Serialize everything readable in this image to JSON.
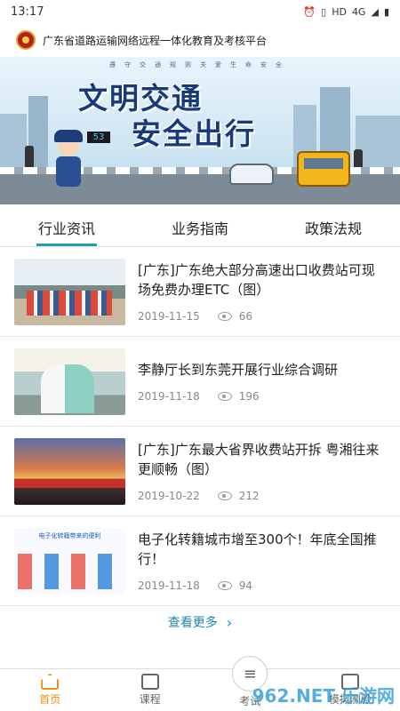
{
  "status_bar": {
    "time": "13:17",
    "network": "4G",
    "hd": "HD"
  },
  "app": {
    "title": "广东省道路运输网络远程一体化教育及考核平台"
  },
  "banner": {
    "subtitle": "遵守交通规则关爱生命安全",
    "line1": "文明交通",
    "line2": "安全出行",
    "sign_number": "53"
  },
  "tabs": [
    {
      "label": "行业资讯",
      "active": true
    },
    {
      "label": "业务指南",
      "active": false
    },
    {
      "label": "政策法规",
      "active": false
    }
  ],
  "news": [
    {
      "title": "[广东]广东绝大部分高速出口收费站可现场免费办理ETC（图）",
      "date": "2019-11-15",
      "views": "66"
    },
    {
      "title": "李静厅长到东莞开展行业综合调研",
      "date": "2019-11-18",
      "views": "196"
    },
    {
      "title": "[广东]广东最大省界收费站开拆 粤湘往来更顺畅（图）",
      "date": "2019-10-22",
      "views": "212"
    },
    {
      "title": "电子化转籍城市增至300个！年底全国推行！",
      "date": "2019-11-18",
      "views": "94"
    }
  ],
  "thumb4_caption": "电子化转籍带来的便利",
  "more": {
    "label": "查看更多"
  },
  "bottom_nav": [
    {
      "label": "首页",
      "icon": "home-icon",
      "active": true
    },
    {
      "label": "课程",
      "icon": "course-icon",
      "active": false
    },
    {
      "label": "考试",
      "icon": "exam-icon",
      "active": false
    },
    {
      "label": "模拟测验",
      "icon": "quiz-icon",
      "active": false
    }
  ],
  "watermark": "962.NET 乐游网",
  "colors": {
    "accent": "#1e9fb1",
    "active_nav": "#e8900c",
    "link": "#1e88b5"
  }
}
